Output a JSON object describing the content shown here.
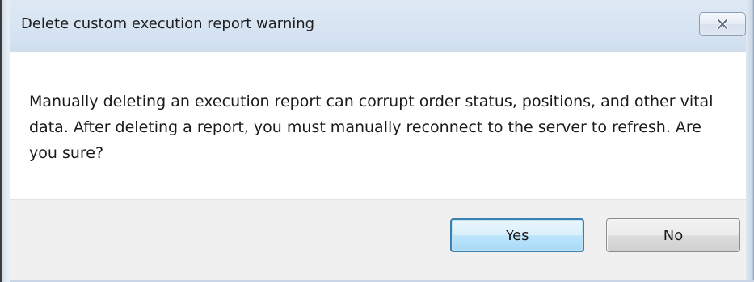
{
  "window": {
    "title": "Delete custom execution report warning",
    "close_icon": "close-x-icon"
  },
  "message": {
    "text": "Manually deleting an execution report can corrupt order status, positions, and other vital data. After deleting a report, you must manually reconnect to the server to refresh. Are you sure?"
  },
  "buttons": {
    "yes_label": "Yes",
    "no_label": "No",
    "default": "Yes"
  },
  "colors": {
    "titlebar": "#d6e3f2",
    "default_button_border": "#3c7fb1",
    "button_bar": "#f0f0f0"
  }
}
